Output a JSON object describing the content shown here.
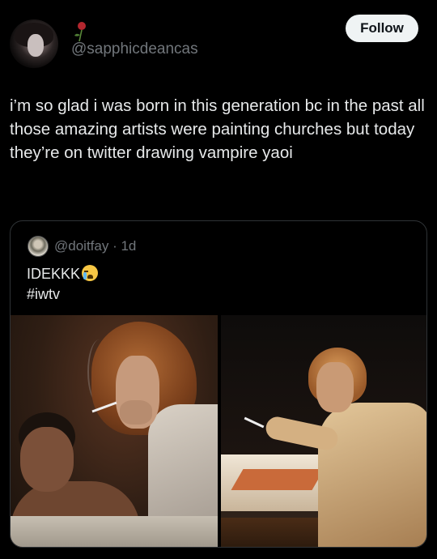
{
  "header": {
    "handle": "@sapphicdeancas",
    "follow_label": "Follow",
    "accent": "#eff3f4"
  },
  "tweet": {
    "text": "i’m so glad i was born in this generation bc in the past all those amazing artists were painting churches but today they’re on twitter drawing vampire yaoi"
  },
  "quote": {
    "author": "@doitfay",
    "time": "· 1d",
    "text_line1": "IDEKKK",
    "text_line2": "#iwtv",
    "emoji": "crying-face-icon"
  },
  "colors": {
    "background": "#000000",
    "text": "#e7e9ea",
    "muted": "#71767b",
    "border": "#2f3336"
  }
}
